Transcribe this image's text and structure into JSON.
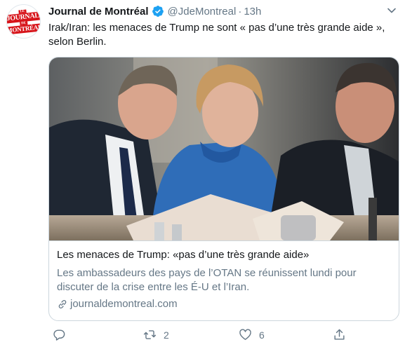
{
  "tweet": {
    "author_name": "Journal de Montréal",
    "handle": "@JdeMontreal",
    "separator": "·",
    "time": "13h",
    "text": "Irak/Iran: les menaces de Trump ne sont « pas d’une très grande aide », selon Berlin."
  },
  "avatar": {
    "logo_line1": "LE",
    "logo_line2": "JOURNAL",
    "logo_line3": "DE",
    "logo_line4": "MONTRÉAL"
  },
  "card": {
    "title": "Les menaces de Trump: «pas d’une très grande aide»",
    "description": "Les ambassadeurs des pays de l’OTAN se réunissent lundi pour discuter de la crise entre les É-U et l’Iran.",
    "domain": "journaldemontreal.com"
  },
  "actions": {
    "reply_count": "",
    "retweet_count": "2",
    "like_count": "6"
  },
  "colors": {
    "accent": "#1da1f2",
    "brand_red": "#d7141a",
    "secondary_text": "#657786",
    "border": "#ccd6dd"
  },
  "icons": [
    "verified-badge-icon",
    "chevron-down-icon",
    "link-icon",
    "reply-icon",
    "retweet-icon",
    "like-icon",
    "share-icon"
  ]
}
